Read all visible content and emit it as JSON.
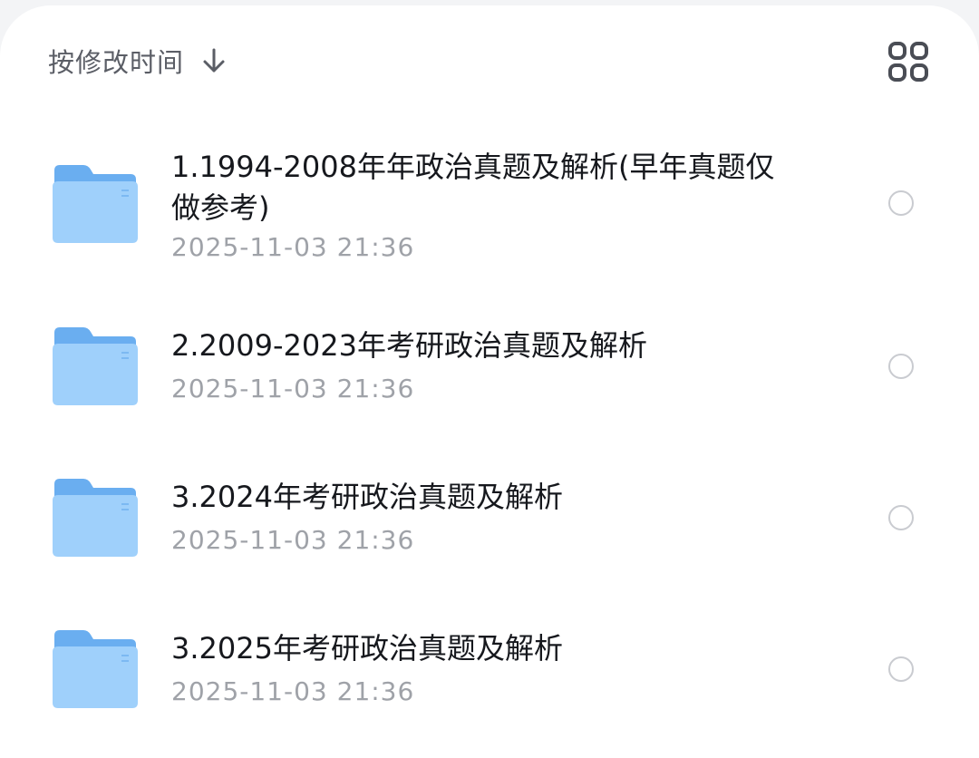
{
  "sort": {
    "label": "按修改时间",
    "direction_icon": "arrow-down-icon"
  },
  "view_toggle": {
    "icon": "grid-view-icon"
  },
  "colors": {
    "folder_back": "#6aaef0",
    "folder_front": "#9fd0fb",
    "radio_border": "#c9cbd0",
    "title_text": "#16181d",
    "time_text": "#9fa2a8"
  },
  "files": [
    {
      "name": "1.1994-2008年年政治真题及解析(早年真题仅做参考)",
      "modified": "2025-11-03 21:36",
      "selected": false
    },
    {
      "name": "2.2009-2023年考研政治真题及解析",
      "modified": "2025-11-03 21:36",
      "selected": false
    },
    {
      "name": "3.2024年考研政治真题及解析",
      "modified": "2025-11-03 21:36",
      "selected": false
    },
    {
      "name": "3.2025年考研政治真题及解析",
      "modified": "2025-11-03 21:36",
      "selected": false
    }
  ]
}
